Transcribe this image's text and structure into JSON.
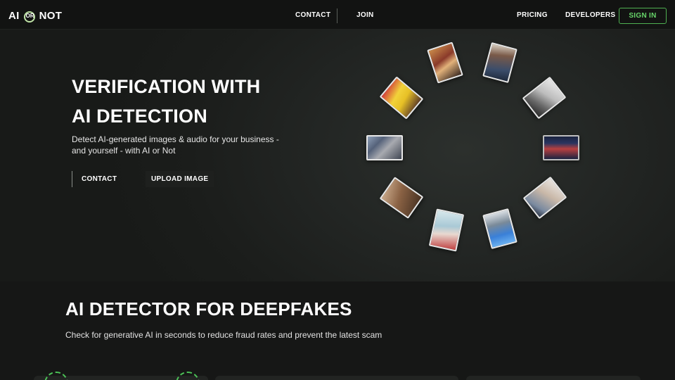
{
  "nav": {
    "logo_ai": "AI",
    "logo_or": "OR",
    "logo_not": "NOT",
    "links": {
      "contact": "CONTACT",
      "join": "JOIN",
      "pricing": "PRICING",
      "developers": "DEVELOPERS"
    },
    "signin": "SIGN IN"
  },
  "hero": {
    "title_line1": "VERIFICATION WITH",
    "title_line2": "AI DETECTION",
    "subtitle": "Detect AI-generated images & audio for your business - and yourself - with AI or Not",
    "btn_contact": "CONTACT",
    "btn_upload": "UPLOAD IMAGE"
  },
  "section2": {
    "title": "AI DETECTOR FOR DEEPFAKES",
    "subtitle": "Check for generative AI in seconds to reduce fraud rates and prevent the latest scam"
  },
  "colors": {
    "accent": "#4fb051",
    "accent_text": "#67d56a",
    "background": "#161716"
  },
  "icons": {
    "logo_or_ring": "ring-icon"
  }
}
